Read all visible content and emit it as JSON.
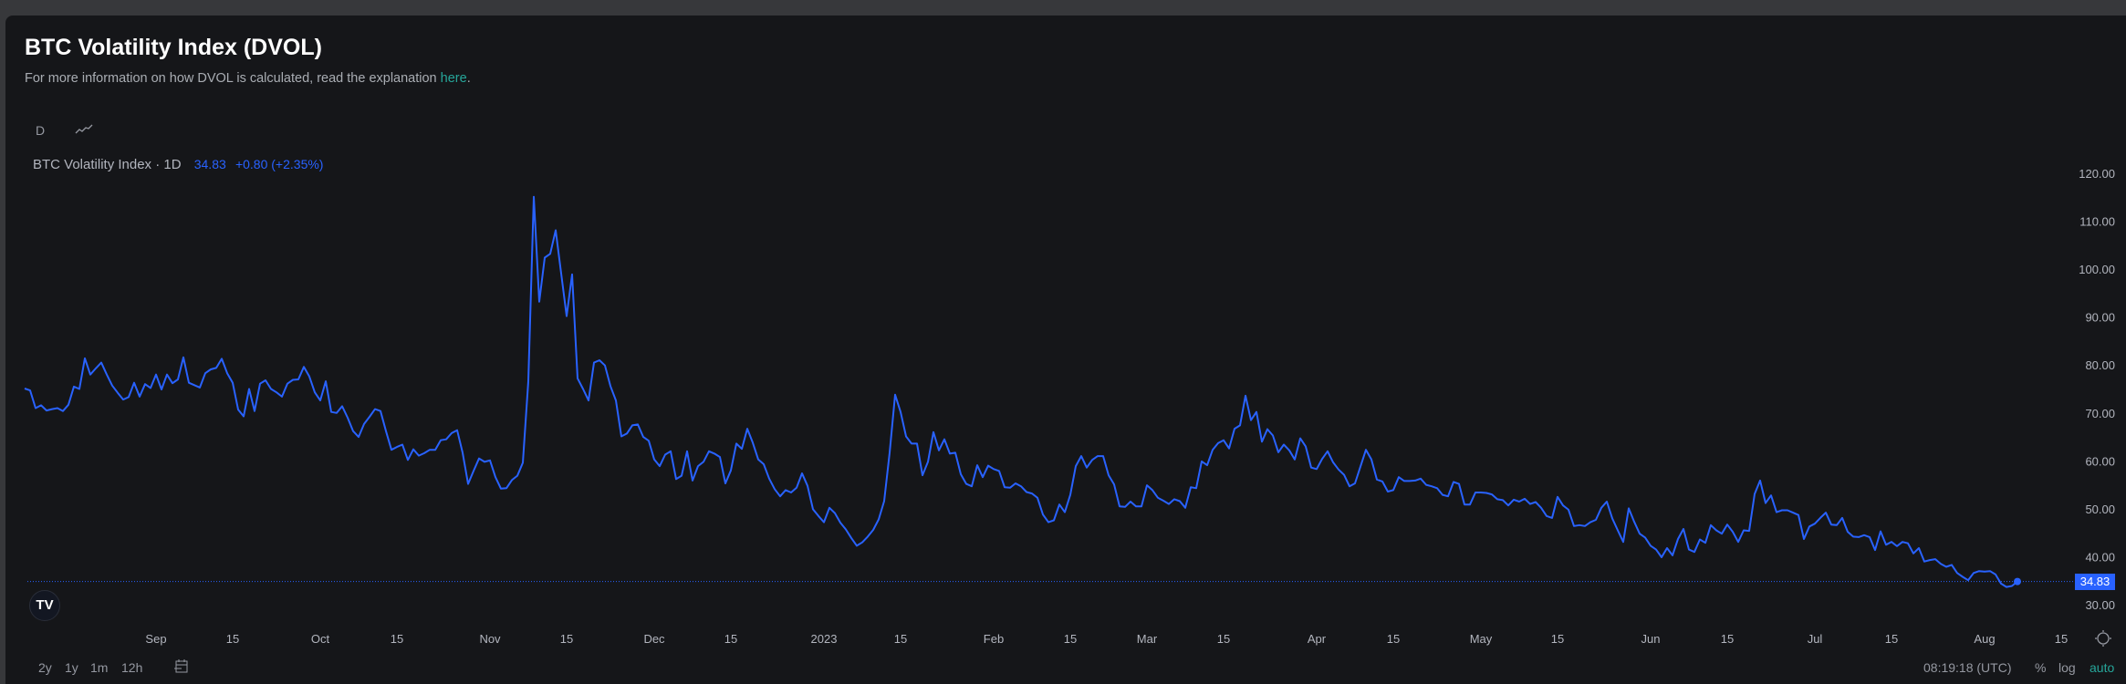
{
  "header": {
    "title": "BTC Volatility Index (DVOL)",
    "subtitle_prefix": "For more information on how DVOL is calculated, read the explanation ",
    "subtitle_link": "here",
    "subtitle_suffix": "."
  },
  "toolbar": {
    "interval": "D",
    "chart_style_icon": "line-chart-icon"
  },
  "legend": {
    "name": "BTC Volatility Index · 1D",
    "last": "34.83",
    "change": "+0.80 (+2.35%)"
  },
  "price_tag": "34.83",
  "logo": "TradingView",
  "bottom_bar": {
    "ranges": [
      "2y",
      "1y",
      "1m",
      "12h"
    ],
    "date_range_icon": "calendar-range-icon",
    "clock": "08:19:18 (UTC)",
    "percent": "%",
    "log": "log",
    "auto": "auto"
  },
  "colors": {
    "line": "#2962ff",
    "accent": "#26a69a",
    "background": "#151619"
  },
  "chart_data": {
    "type": "line",
    "title": "BTC Volatility Index · 1D",
    "start_date": "2022-08-08",
    "interval": "1D",
    "ylim": [
      30,
      120
    ],
    "yticks": [
      "120.00",
      "110.00",
      "100.00",
      "90.00",
      "80.00",
      "70.00",
      "60.00",
      "50.00",
      "40.00",
      "30.00"
    ],
    "ytick_values": [
      120,
      110,
      100,
      90,
      80,
      70,
      60,
      50,
      40,
      30
    ],
    "xticks": [
      {
        "label": "Sep",
        "date": "2022-09-01"
      },
      {
        "label": "15",
        "date": "2022-09-15"
      },
      {
        "label": "Oct",
        "date": "2022-10-01"
      },
      {
        "label": "15",
        "date": "2022-10-15"
      },
      {
        "label": "Nov",
        "date": "2022-11-01"
      },
      {
        "label": "15",
        "date": "2022-11-15"
      },
      {
        "label": "Dec",
        "date": "2022-12-01"
      },
      {
        "label": "15",
        "date": "2022-12-15"
      },
      {
        "label": "2023",
        "date": "2023-01-01"
      },
      {
        "label": "15",
        "date": "2023-01-15"
      },
      {
        "label": "Feb",
        "date": "2023-02-01"
      },
      {
        "label": "15",
        "date": "2023-02-15"
      },
      {
        "label": "Mar",
        "date": "2023-03-01"
      },
      {
        "label": "15",
        "date": "2023-03-15"
      },
      {
        "label": "Apr",
        "date": "2023-04-01"
      },
      {
        "label": "15",
        "date": "2023-04-15"
      },
      {
        "label": "May",
        "date": "2023-05-01"
      },
      {
        "label": "15",
        "date": "2023-05-15"
      },
      {
        "label": "Jun",
        "date": "2023-06-01"
      },
      {
        "label": "15",
        "date": "2023-06-15"
      },
      {
        "label": "Jul",
        "date": "2023-07-01"
      },
      {
        "label": "15",
        "date": "2023-07-15"
      },
      {
        "label": "Aug",
        "date": "2023-08-01"
      },
      {
        "label": "15",
        "date": "2023-08-15"
      }
    ],
    "last_value": 34.83,
    "values": [
      75.1,
      74.7,
      71.0,
      71.6,
      70.5,
      70.8,
      71.0,
      70.4,
      71.7,
      75.5,
      75.0,
      81.4,
      78.0,
      79.3,
      80.5,
      78.0,
      75.7,
      74.2,
      72.8,
      73.3,
      76.3,
      73.4,
      76.0,
      75.2,
      78.0,
      74.9,
      78.0,
      76.2,
      77.0,
      81.6,
      76.3,
      75.8,
      75.3,
      78.3,
      79.1,
      79.4,
      81.3,
      78.3,
      76.3,
      70.7,
      69.3,
      75.0,
      70.4,
      76.1,
      76.8,
      75.0,
      74.3,
      73.4,
      76.1,
      76.9,
      77.0,
      79.6,
      77.6,
      74.3,
      72.6,
      76.6,
      70.2,
      70.0,
      71.4,
      69.0,
      66.2,
      65.0,
      67.7,
      69.2,
      70.8,
      70.4,
      66.2,
      62.3,
      62.9,
      63.4,
      60.2,
      62.4,
      61.1,
      61.6,
      62.3,
      62.3,
      64.3,
      64.5,
      65.8,
      66.4,
      61.7,
      55.2,
      57.9,
      60.5,
      59.8,
      60.1,
      56.6,
      54.2,
      54.3,
      56.0,
      56.9,
      59.6,
      76.6,
      115.1,
      93.2,
      102.4,
      103.2,
      108.1,
      99.1,
      90.2,
      98.9,
      77.2,
      75.0,
      72.6,
      80.5,
      81.0,
      79.9,
      75.6,
      72.6,
      65.1,
      65.7,
      67.4,
      67.6,
      65.0,
      64.2,
      60.3,
      58.9,
      61.3,
      62.0,
      56.2,
      56.9,
      62.0,
      55.9,
      58.9,
      59.8,
      62.0,
      61.5,
      60.8,
      55.3,
      58.0,
      63.6,
      62.5,
      66.7,
      63.8,
      60.3,
      59.3,
      56.3,
      54.1,
      52.6,
      53.9,
      53.4,
      54.4,
      57.4,
      54.8,
      49.9,
      48.5,
      47.2,
      50.2,
      49.1,
      47.1,
      45.7,
      43.9,
      42.3,
      43.0,
      44.2,
      45.6,
      47.8,
      51.6,
      61.7,
      73.8,
      70.2,
      65.1,
      63.6,
      63.6,
      57.0,
      59.8,
      66.0,
      62.2,
      64.5,
      61.5,
      61.7,
      57.2,
      55.2,
      54.7,
      59.1,
      56.6,
      59.0,
      58.3,
      57.9,
      54.5,
      54.4,
      55.3,
      54.7,
      53.5,
      53.2,
      52.3,
      48.8,
      47.2,
      47.6,
      50.9,
      49.3,
      52.9,
      58.9,
      61.0,
      58.6,
      60.2,
      61.0,
      61.0,
      57.0,
      55.1,
      50.5,
      50.4,
      51.5,
      50.5,
      50.5,
      54.9,
      53.9,
      52.3,
      51.7,
      51.0,
      52.0,
      51.6,
      50.2,
      54.5,
      54.3,
      59.9,
      59.1,
      62.3,
      63.7,
      64.3,
      62.6,
      66.7,
      67.4,
      73.6,
      68.5,
      70.2,
      64.0,
      66.6,
      65.3,
      61.8,
      63.4,
      62.2,
      60.3,
      64.7,
      63.0,
      58.6,
      58.3,
      60.4,
      62.0,
      59.7,
      58.2,
      57.1,
      54.7,
      55.3,
      58.8,
      62.3,
      60.3,
      56.1,
      55.7,
      53.6,
      53.9,
      56.6,
      55.8,
      55.8,
      55.9,
      56.3,
      55.0,
      54.7,
      54.3,
      52.9,
      52.6,
      55.6,
      55.2,
      50.9,
      50.9,
      53.4,
      53.4,
      53.3,
      53.0,
      52.0,
      51.8,
      50.7,
      51.9,
      51.5,
      52.1,
      51.0,
      51.4,
      50.2,
      48.5,
      48.1,
      52.5,
      50.7,
      49.8,
      46.4,
      46.6,
      46.4,
      47.2,
      47.7,
      50.2,
      51.5,
      48.0,
      45.5,
      43.1,
      50.1,
      47.3,
      44.8,
      44.0,
      42.3,
      41.5,
      39.9,
      41.8,
      40.3,
      43.7,
      45.8,
      41.5,
      41.0,
      43.6,
      42.9,
      46.6,
      45.5,
      44.8,
      46.7,
      45.2,
      43.1,
      45.5,
      45.4,
      53.1,
      55.9,
      51.2,
      52.8,
      49.3,
      49.7,
      49.7,
      49.2,
      48.7,
      43.7,
      46.3,
      46.9,
      48.1,
      49.2,
      46.7,
      46.6,
      48.1,
      45.2,
      44.2,
      44.1,
      44.5,
      44.1,
      41.4,
      45.3,
      42.5,
      43.1,
      42.2,
      43.1,
      42.8,
      40.7,
      41.8,
      39.0,
      39.3,
      39.5,
      38.5,
      37.9,
      38.3,
      36.6,
      35.8,
      35.1,
      36.6,
      37.0,
      36.9,
      37.0,
      36.3,
      34.4,
      33.7,
      33.9,
      34.83
    ]
  }
}
